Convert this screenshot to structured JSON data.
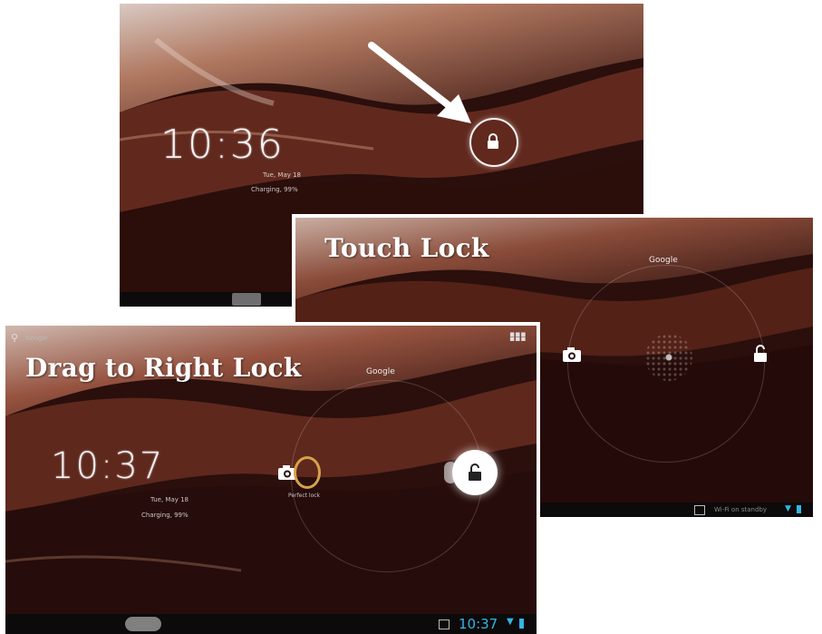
{
  "captions": {
    "touch_lock": "Touch Lock",
    "drag_lock": "Drag to Right Lock"
  },
  "screen1": {
    "time": "10:36",
    "date": "Tue, May 18",
    "battery": "Charging, 99%"
  },
  "screen2": {
    "google_label": "Google",
    "status_text": "Wi-Fi on standby"
  },
  "screen3": {
    "search_label": "Google",
    "google_label": "Google",
    "time": "10:37",
    "date": "Tue, May 18",
    "battery": "Charging, 99%",
    "camera_hint": "Perfect lock",
    "status_time": "10:37"
  },
  "colors": {
    "wall_dark": "#2a0f0c",
    "wall_mid": "#6b2e22",
    "wall_light": "#b87a63",
    "accent_blue": "#33b5e5"
  },
  "icons": [
    "lock-icon",
    "unlock-icon",
    "camera-icon",
    "apps-grid-icon",
    "search-icon",
    "wifi-icon",
    "battery-icon",
    "gallery-icon",
    "arrow-icon"
  ]
}
